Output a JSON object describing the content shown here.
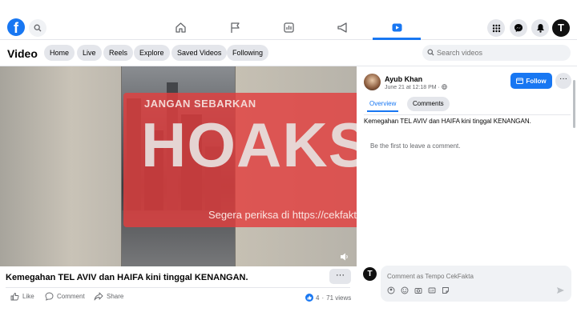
{
  "nav": {
    "logo": "f",
    "icons": [
      "home-icon",
      "flag-icon",
      "chart-icon",
      "megaphone-icon",
      "video-icon"
    ],
    "active": "video-icon",
    "right_icons": [
      "grid-icon",
      "messenger-icon",
      "bell-icon"
    ],
    "profile_initial": "T"
  },
  "subbar": {
    "title": "Video",
    "pills": [
      "Home",
      "Live",
      "Reels",
      "Explore",
      "Saved Videos",
      "Following"
    ],
    "search_placeholder": "Search videos"
  },
  "overlay": {
    "banner": "JANGAN SEBARKAN",
    "stamp": "HOAKS",
    "check_prefix": "Segera periksa di ",
    "check_url": "https://cekfakta.tempo.co"
  },
  "video": {
    "caption": "Kemegahan TEL AVIV dan HAIFA kini tinggal KENANGAN.",
    "more": "···",
    "actions": [
      "Like",
      "Comment",
      "Share"
    ],
    "reaction_count": "4",
    "views": "71 views"
  },
  "panel": {
    "author_name": "Ayub Khan",
    "author_meta": "June 21 at 12:18 PM · ",
    "follow_label": "Follow",
    "more": "···",
    "tabs": [
      "Overview",
      "Comments"
    ],
    "post_text": "Kemegahan TEL AVIV dan HAIFA kini tinggal KENANGAN.",
    "no_comments": "Be the first to leave a comment.",
    "comment_placeholder": "Comment as Tempo CekFakta",
    "commenter_initial": "T"
  },
  "colors": {
    "brand": "#1877f2",
    "hoax_red": "#e23e3e"
  }
}
